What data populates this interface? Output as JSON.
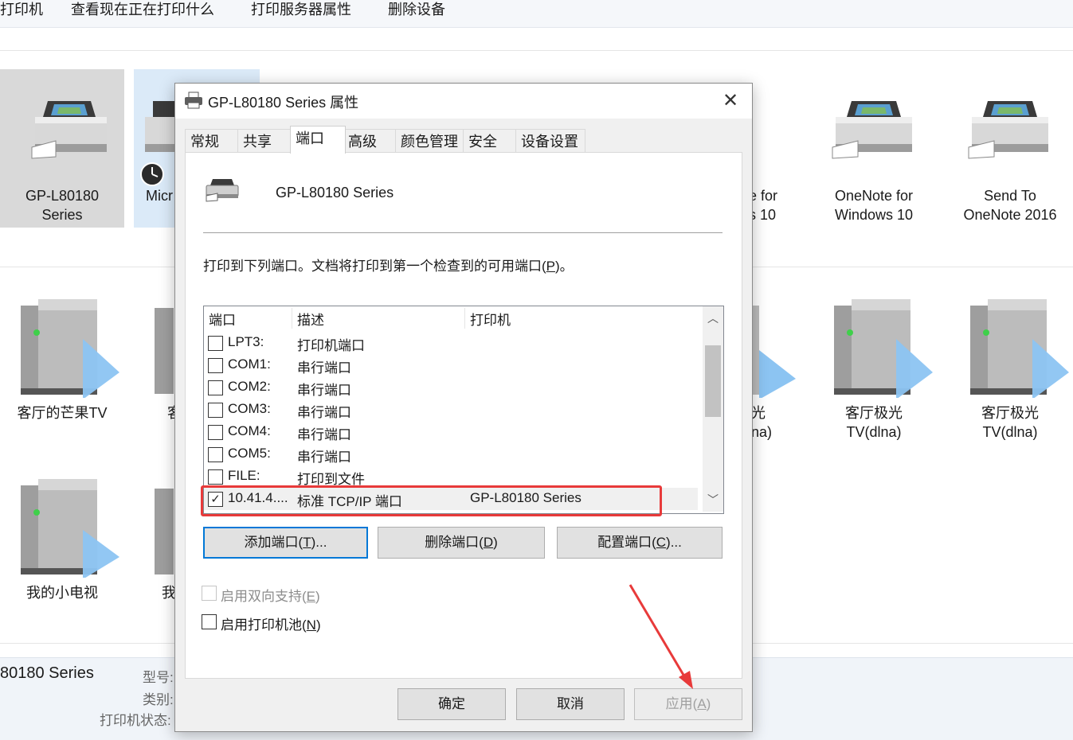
{
  "toolbar": {
    "items": [
      "打印机",
      "查看现在正在打印什么",
      "打印服务器属性",
      "删除设备"
    ]
  },
  "printers": [
    {
      "label_line1": "GP-L80180",
      "label_line2": "Series"
    },
    {
      "label_line1": "Micr",
      "label_line2": ""
    },
    {
      "label_line1": "e for",
      "label_line2": "s 10"
    },
    {
      "label_line1": "OneNote for",
      "label_line2": "Windows 10"
    },
    {
      "label_line1": "Send To",
      "label_line2": "OneNote 2016"
    }
  ],
  "media_devices_row1": [
    {
      "label_line1": "客厅的芒果TV",
      "label_line2": ""
    },
    {
      "label_line1": "客",
      "label_line2": ""
    },
    {
      "label_line1": "光",
      "label_line2": "na)"
    },
    {
      "label_line1": "客厅极光",
      "label_line2": "TV(dlna)"
    },
    {
      "label_line1": "客厅极光",
      "label_line2": "TV(dlna)"
    }
  ],
  "media_devices_row2": [
    {
      "label_line1": "我的小电视"
    },
    {
      "label_line1": "我"
    }
  ],
  "details_pane": {
    "name": "80180 Series",
    "model_label": "型号:",
    "category_label": "类别:",
    "status_label": "打印机状态:"
  },
  "dialog": {
    "title": "GP-L80180 Series 属性",
    "close_glyph": "✕",
    "tabs": [
      "常规",
      "共享",
      "端口",
      "高级",
      "颜色管理",
      "安全",
      "设备设置"
    ],
    "active_tab": "端口",
    "printer_name": "GP-L80180 Series",
    "description_text": "打印到下列端口。文档将打印到第一个检查到的可用端口(",
    "description_key": "P",
    "description_tail": ")。",
    "columns": [
      "端口",
      "描述",
      "打印机"
    ],
    "ports": [
      {
        "port": "LPT3:",
        "desc": "打印机端口",
        "printer": "",
        "checked": false
      },
      {
        "port": "COM1:",
        "desc": "串行端口",
        "printer": "",
        "checked": false
      },
      {
        "port": "COM2:",
        "desc": "串行端口",
        "printer": "",
        "checked": false
      },
      {
        "port": "COM3:",
        "desc": "串行端口",
        "printer": "",
        "checked": false
      },
      {
        "port": "COM4:",
        "desc": "串行端口",
        "printer": "",
        "checked": false
      },
      {
        "port": "COM5:",
        "desc": "串行端口",
        "printer": "",
        "checked": false
      },
      {
        "port": "FILE:",
        "desc": "打印到文件",
        "printer": "",
        "checked": false
      },
      {
        "port": "10.41.4....",
        "desc": "标准 TCP/IP 端口",
        "printer": "GP-L80180 Series",
        "checked": true
      }
    ],
    "buttons": {
      "add_port": {
        "text": "添加端口(",
        "key": "T",
        "tail": ")..."
      },
      "delete_port": {
        "text": "删除端口(",
        "key": "D",
        "tail": ")"
      },
      "configure_port": {
        "text": "配置端口(",
        "key": "C",
        "tail": ")..."
      },
      "ok": "确定",
      "cancel": "取消",
      "apply": {
        "text": "应用(",
        "key": "A",
        "tail": ")"
      }
    },
    "bidirectional": {
      "text": "启用双向支持(",
      "key": "E",
      "tail": ")",
      "checked": false,
      "enabled": false
    },
    "pooling": {
      "text": "启用打印机池(",
      "key": "N",
      "tail": ")",
      "checked": false,
      "enabled": true
    }
  },
  "colors": {
    "highlight_red": "#e83a3a",
    "focus_blue": "#0078d7",
    "media_play_blue": "#8cc4f2"
  },
  "icons": [
    "printer-icon",
    "media-server-icon",
    "clock-overlay-icon",
    "close-icon",
    "checkmark-icon",
    "chevron-up-icon",
    "chevron-down-icon"
  ]
}
